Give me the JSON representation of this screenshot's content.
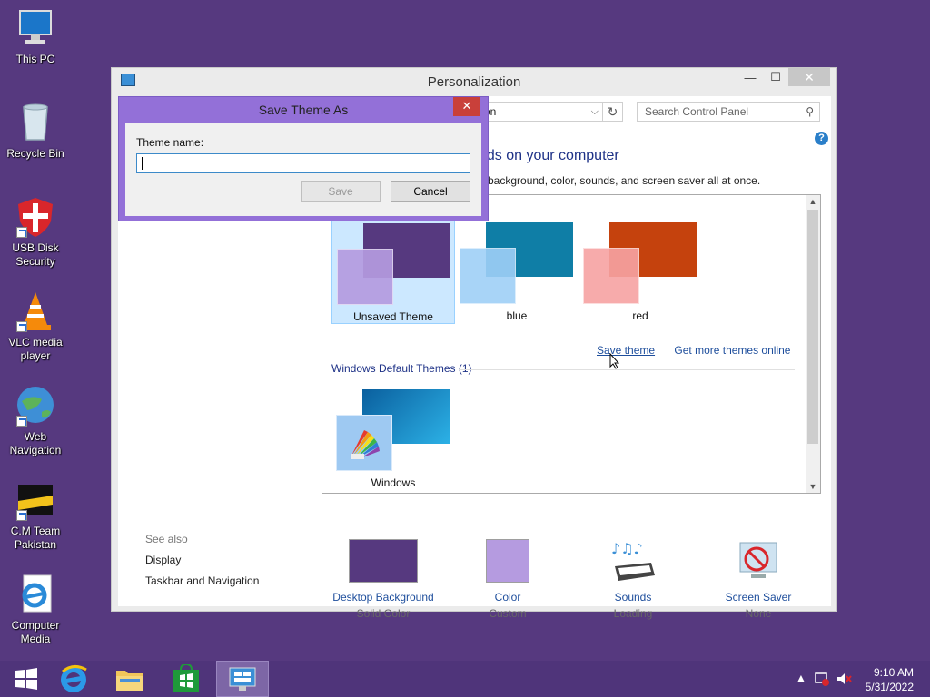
{
  "desktop": {
    "icons": [
      {
        "label": "This PC",
        "icon": "computer-icon"
      },
      {
        "label": "Recycle Bin",
        "icon": "recycle-bin-icon"
      },
      {
        "label": "USB Disk Security",
        "icon": "shield-icon"
      },
      {
        "label": "VLC media player",
        "icon": "vlc-cone-icon"
      },
      {
        "label": "Web Navigation",
        "icon": "globe-icon"
      },
      {
        "label": "C.M Team Pakistan",
        "icon": "cm-team-icon"
      },
      {
        "label": "Computer Media",
        "icon": "ie-document-icon"
      }
    ]
  },
  "window": {
    "title": "Personalization",
    "address_text": "on",
    "search_placeholder": "Search Control Panel",
    "heading": "nds on your computer",
    "subtext": "p background, color, sounds, and screen saver all at once.",
    "themes": [
      {
        "label": "Unsaved Theme",
        "selected": true,
        "bg_color": "#56397f",
        "fg_color": "#b59be0"
      },
      {
        "label": "blue",
        "selected": false,
        "bg_color": "#0f7ea6",
        "fg_color": "#9fd0f7"
      },
      {
        "label": "red",
        "selected": false,
        "bg_color": "#c5420d",
        "fg_color": "#f7a3a3"
      }
    ],
    "save_theme_link": "Save theme",
    "more_themes_link": "Get more themes online",
    "default_section_label": "Windows Default Themes (1)",
    "default_theme": {
      "label": "Windows"
    },
    "see_also": {
      "title": "See also",
      "items": [
        "Display",
        "Taskbar and Navigation"
      ]
    },
    "bottom": [
      {
        "label": "Desktop Background",
        "sublabel": "Solid Color"
      },
      {
        "label": "Color",
        "sublabel": "Custom"
      },
      {
        "label": "Sounds",
        "sublabel": "Loading"
      },
      {
        "label": "Screen Saver",
        "sublabel": "None"
      }
    ]
  },
  "dialog": {
    "title": "Save Theme As",
    "field_label": "Theme name:",
    "field_value": "",
    "save_label": "Save",
    "cancel_label": "Cancel"
  },
  "taskbar": {
    "time": "9:10 AM",
    "date": "5/31/2022"
  },
  "colors": {
    "desktop": "#56397f",
    "dialog_frame": "#9370d8",
    "link": "#1e4e9c"
  }
}
